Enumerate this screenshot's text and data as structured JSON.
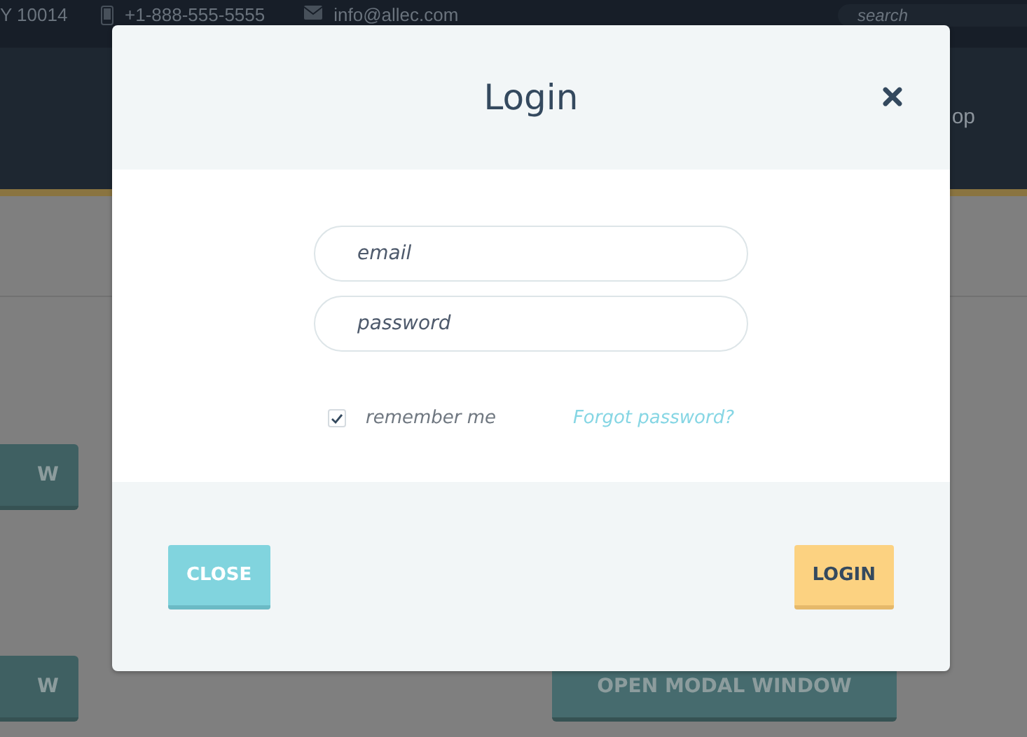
{
  "top_bar": {
    "address": "Y 10014",
    "phone": "+1-888-555-5555",
    "email": "info@allec.com",
    "search": {
      "placeholder": "search"
    }
  },
  "header": {
    "nav_item": "op"
  },
  "page_buttons": [
    {
      "label": "W"
    },
    {
      "label": "W"
    },
    {
      "label": "OPEN MODAL WINDOW"
    }
  ],
  "modal": {
    "title": "Login",
    "fields": [
      {
        "placeholder": "email"
      },
      {
        "placeholder": "password"
      }
    ],
    "remember": {
      "label": "remember me",
      "checked": true
    },
    "forgot_link": "Forgot password?",
    "buttons": [
      {
        "label": "CLOSE",
        "kind": "secondary"
      },
      {
        "label": "LOGIN",
        "kind": "primary"
      }
    ]
  }
}
